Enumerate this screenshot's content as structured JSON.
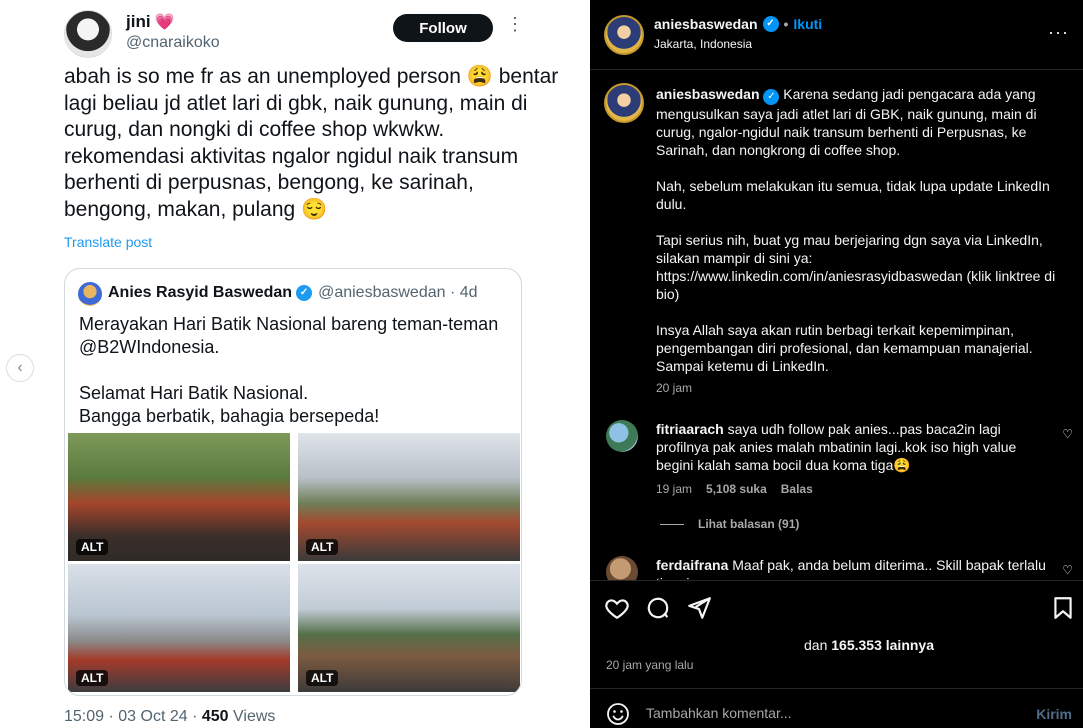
{
  "tweet": {
    "author_name": "jini",
    "author_heart": "💗",
    "author_handle": "@cnaraikoko",
    "follow_label": "Follow",
    "more_glyph": "⋮",
    "body": "abah is so me fr as an unemployed person 😩 bentar lagi beliau jd atlet lari di gbk, naik gunung, main di curug, dan nongki di coffee shop wkwkw. rekomendasi aktivitas ngalor ngidul naik transum berhenti di perpusnas, bengong, ke sarinah, bengong, makan, pulang 😌",
    "translate_label": "Translate post",
    "quote": {
      "name": "Anies Rasyid Baswedan",
      "handle_time": "@aniesbaswedan · 4d",
      "lines": [
        "Merayakan Hari Batik Nasional bareng teman-teman @B2WIndonesia.",
        "Selamat Hari Batik Nasional.",
        "Bangga berbatik, bahagia bersepeda!"
      ],
      "alt_label": "ALT"
    },
    "timestamp": "15:09 · 03 Oct 24 · ",
    "views_count": "450",
    "views_label": " Views"
  },
  "prev_glyph": "‹",
  "instagram": {
    "username": "aniesbaswedan",
    "follow_label": "Ikuti",
    "dot": "•",
    "location": "Jakarta, Indonesia",
    "more_glyph": "···",
    "caption": {
      "username": "aniesbaswedan",
      "p1": "Karena sedang jadi pengacara ada yang mengusulkan saya jadi atlet lari di GBK, naik gunung, main di curug, ngalor-ngidul naik transum berhenti di Perpusnas, ke Sarinah, dan nongkrong di coffee shop.",
      "p2": "Nah, sebelum melakukan itu semua, tidak lupa update LinkedIn dulu.",
      "p3": "Tapi serius nih, buat yg mau berjejaring dgn saya via LinkedIn, silakan mampir di sini ya: https://www.linkedin.com/in/aniesrasyidbaswedan (klik linktree di bio)",
      "p4": "Insya Allah saya akan rutin berbagi terkait kepemimpinan, pengembangan diri profesional, dan kemampuan manajerial. Sampai ketemu di LinkedIn.",
      "time": "20 jam"
    },
    "comments": [
      {
        "username": "fitriaarach",
        "text": "saya udh follow pak anies...pas baca2in lagi profilnya pak anies malah mbatinin lagi..kok iso high value begini kalah sama bocil dua koma tiga😩",
        "time": "19 jam",
        "likes": "5,108 suka",
        "reply": "Balas",
        "view_replies": "Lihat balasan (91)"
      },
      {
        "username": "ferdaifrana",
        "text": "Maaf pak, anda belum diterima.. Skill bapak terlalu tinggi"
      }
    ],
    "likes_prefix": "dan ",
    "likes_count": "165.353",
    "likes_suffix": " lainnya",
    "post_time": "20 jam yang lalu",
    "comment_placeholder": "Tambahkan komentar...",
    "send_label": "Kirim"
  },
  "colors": {
    "ig_blue": "#0095f6",
    "twitter_blue": "#1d9bf0",
    "ig_bg": "#000000"
  }
}
